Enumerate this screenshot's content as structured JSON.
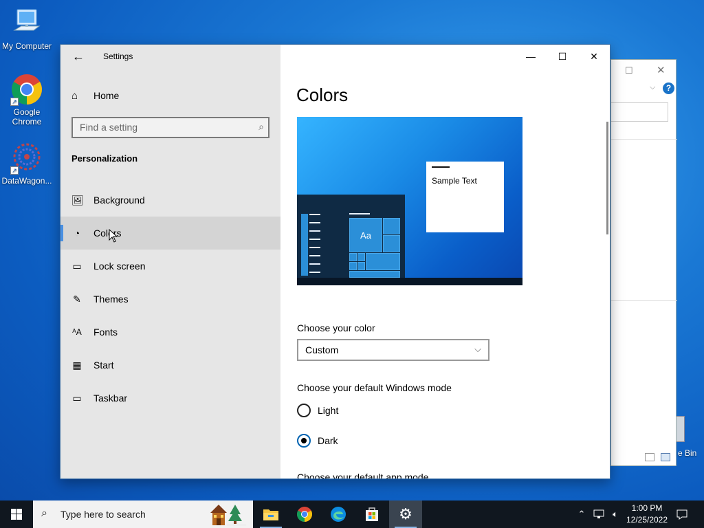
{
  "desktop": {
    "icons": [
      {
        "label": "My Computer"
      },
      {
        "label": "Google Chrome"
      },
      {
        "label": "DataWagon..."
      }
    ],
    "recycle_partial": "e Bin"
  },
  "window": {
    "title": "Settings",
    "back_icon": "arrow-left-icon",
    "controls": {
      "minimize": "—",
      "maximize": "☐",
      "close": "✕"
    }
  },
  "sidebar": {
    "home_label": "Home",
    "search_placeholder": "Find a setting",
    "section_title": "Personalization",
    "items": [
      {
        "label": "Background",
        "icon": "picture-icon"
      },
      {
        "label": "Colors",
        "icon": "palette-icon",
        "selected": true
      },
      {
        "label": "Lock screen",
        "icon": "lock-screen-icon"
      },
      {
        "label": "Themes",
        "icon": "brush-icon"
      },
      {
        "label": "Fonts",
        "icon": "font-icon"
      },
      {
        "label": "Start",
        "icon": "start-grid-icon"
      },
      {
        "label": "Taskbar",
        "icon": "taskbar-icon"
      }
    ]
  },
  "main": {
    "title": "Colors",
    "preview": {
      "sample_text": "Sample Text",
      "tile_text": "Aa"
    },
    "choose_color_label": "Choose your color",
    "choose_color_value": "Custom",
    "windows_mode_label": "Choose your default Windows mode",
    "windows_mode_options": [
      {
        "label": "Light",
        "selected": false
      },
      {
        "label": "Dark",
        "selected": true
      }
    ],
    "app_mode_label": "Choose your default app mode"
  },
  "taskbar": {
    "search_placeholder": "Type here to search",
    "apps": [
      "file-explorer-icon",
      "chrome-icon",
      "edge-icon",
      "store-icon",
      "settings-icon"
    ],
    "time": "1:00 PM",
    "date": "12/25/2022"
  },
  "colors": {
    "accent": "#0063b1",
    "sidebar_bg": "#e6e6e6",
    "selected_bg": "#d4d4d4"
  }
}
